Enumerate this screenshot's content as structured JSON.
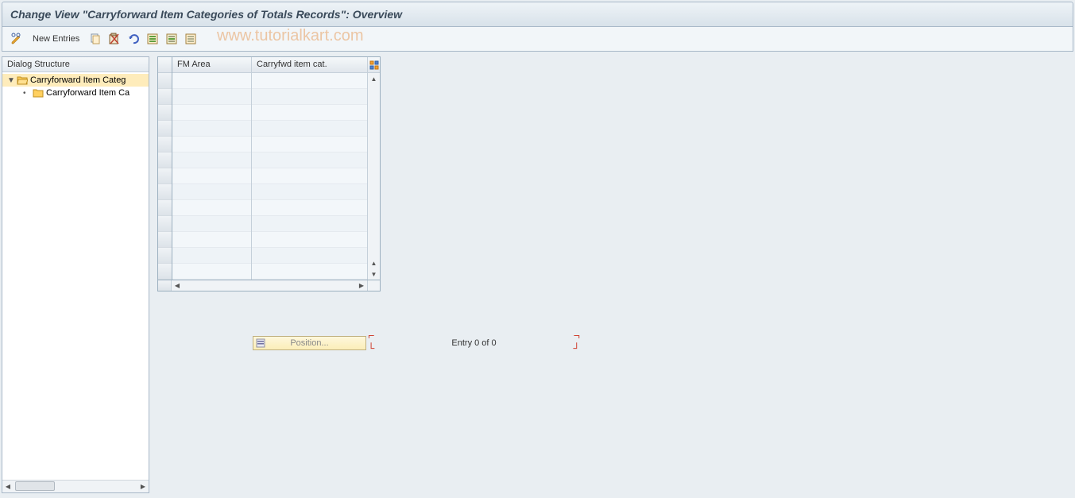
{
  "title": "Change View \"Carryforward Item Categories of Totals Records\": Overview",
  "watermark": "www.tutorialkart.com",
  "toolbar": {
    "new_entries_label": "New Entries"
  },
  "dialog_structure": {
    "header": "Dialog Structure",
    "items": [
      {
        "label": "Carryforward Item Categ",
        "level": 0,
        "expanded": true,
        "selected": true,
        "icon": "folder-open"
      },
      {
        "label": "Carryforward Item Ca",
        "level": 1,
        "expanded": false,
        "selected": false,
        "icon": "folder"
      }
    ]
  },
  "table": {
    "columns": [
      {
        "label": "FM Area",
        "width": 100
      },
      {
        "label": "Carryfwd item cat.",
        "width": 145
      }
    ],
    "rows": [
      [
        "",
        ""
      ],
      [
        "",
        ""
      ],
      [
        "",
        ""
      ],
      [
        "",
        ""
      ],
      [
        "",
        ""
      ],
      [
        "",
        ""
      ],
      [
        "",
        ""
      ],
      [
        "",
        ""
      ],
      [
        "",
        ""
      ],
      [
        "",
        ""
      ],
      [
        "",
        ""
      ],
      [
        "",
        ""
      ],
      [
        "",
        ""
      ]
    ]
  },
  "position": {
    "button_label": "Position...",
    "entry_text": "Entry 0 of 0"
  },
  "icons": {
    "change": "change-icon",
    "copy": "copy-icon",
    "save": "save-icon",
    "undo": "undo-icon",
    "select_all": "select-all-icon",
    "select_block": "select-block-icon",
    "deselect": "deselect-icon"
  }
}
